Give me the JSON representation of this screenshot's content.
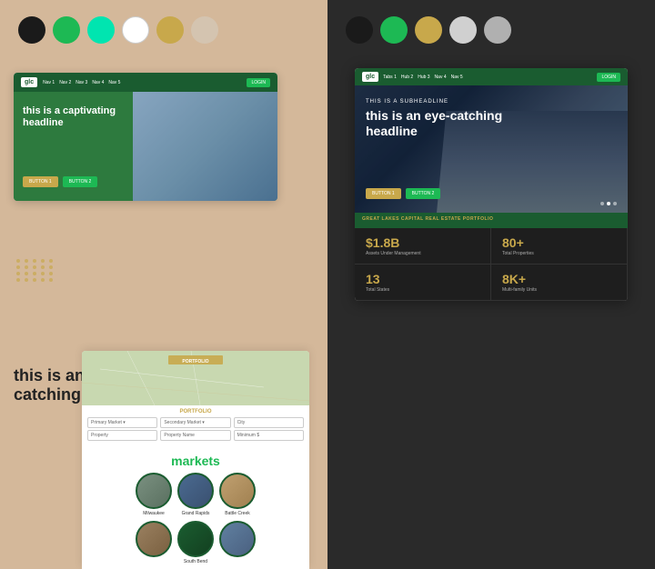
{
  "left_panel": {
    "background": "#d4b89a",
    "swatches": [
      {
        "color": "#1a1a1a",
        "label": "black"
      },
      {
        "color": "#1db954",
        "label": "green"
      },
      {
        "color": "#00e5b0",
        "label": "teal"
      },
      {
        "color": "#ffffff",
        "label": "white"
      },
      {
        "color": "#c8a84b",
        "label": "gold"
      },
      {
        "color": "#d4c4b0",
        "label": "light-beige"
      }
    ],
    "mockup": {
      "logo": "glc",
      "nav_items": [
        "Nav 1",
        "Nav 2",
        "Nav 3",
        "Nav 4",
        "Nav 5"
      ],
      "login_label": "LOGIN",
      "hero_headline": "this is a captivating headline",
      "button1": "BUTTON 1",
      "button2": "BUTTON 2"
    },
    "subheadline": "this is another eye-catching subheadline",
    "markets": {
      "title": "markets",
      "items": [
        {
          "name": "Milwaukee",
          "class": "market-img-milwaukee"
        },
        {
          "name": "Grand Rapids",
          "class": "market-img-grandrapids"
        },
        {
          "name": "Battle Creek",
          "class": "market-img-battlecreek"
        },
        {
          "name": "",
          "class": "market-img-dallas"
        },
        {
          "name": "South Bend",
          "class": "market-img-southbend"
        },
        {
          "name": "",
          "class": "market-img-nashville"
        }
      ]
    }
  },
  "right_panel": {
    "background": "#2a2a2a",
    "swatches": [
      {
        "color": "#1a1a1a",
        "label": "black"
      },
      {
        "color": "#1db954",
        "label": "green"
      },
      {
        "color": "#c8a84b",
        "label": "gold"
      },
      {
        "color": "#d0d0d0",
        "label": "light-gray"
      },
      {
        "color": "#b0b0b0",
        "label": "gray"
      }
    ],
    "mockup": {
      "logo": "glc",
      "nav_items": [
        "Tabs 1",
        "Hub 2",
        "Hub 3",
        "Nav 4",
        "Nav 5"
      ],
      "login_label": "LOGIN",
      "hero_subheadline": "THIS IS A SUBHEADLINE",
      "hero_headline": "this is an eye-catching headline",
      "button1": "BUTTON 1",
      "button2": "BUTTON 2"
    },
    "stats": {
      "label": "GREAT LAKES CAPITAL REAL ESTATE PORTFOLIO",
      "items": [
        {
          "value": "$1.8B",
          "label": "Assets Under Management"
        },
        {
          "value": "80+",
          "label": "Total Properties"
        },
        {
          "value": "13",
          "label": "Total States"
        },
        {
          "value": "8K+",
          "label": "Multi-family Units"
        }
      ]
    }
  }
}
